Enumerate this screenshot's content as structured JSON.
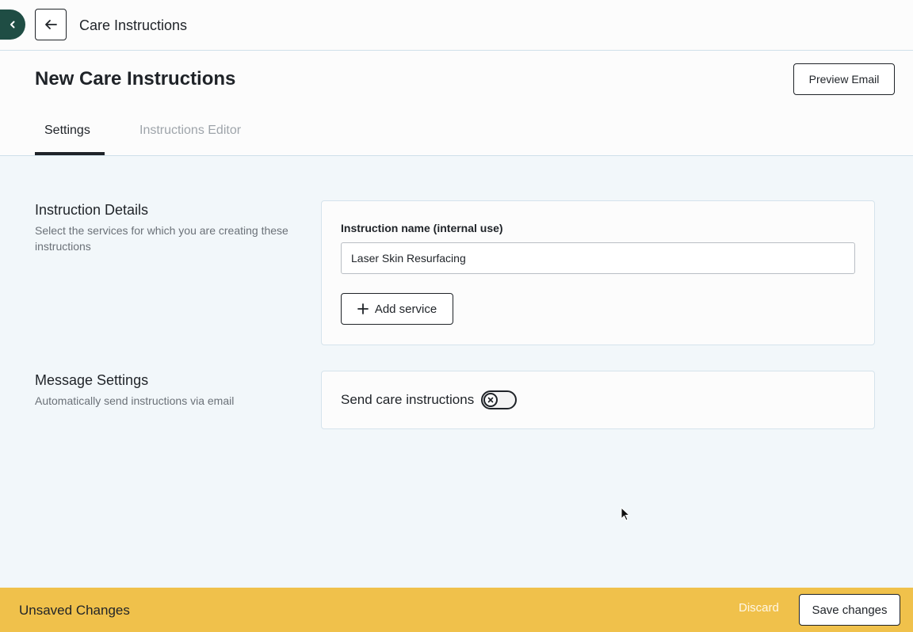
{
  "topbar": {
    "title": "Care Instructions",
    "collapse_icon": "chevron-left-icon",
    "back_icon": "arrow-left-icon"
  },
  "header": {
    "page_title": "New Care Instructions",
    "preview_label": "Preview Email",
    "tabs": [
      {
        "label": "Settings",
        "active": true
      },
      {
        "label": "Instructions Editor",
        "active": false
      }
    ]
  },
  "instruction_details": {
    "title": "Instruction Details",
    "description": "Select the services for which you are creating these instructions",
    "field_label": "Instruction name (internal use)",
    "field_value": "Laser Skin Resurfacing",
    "add_service_label": "Add service",
    "add_icon": "plus-icon"
  },
  "message_settings": {
    "title": "Message Settings",
    "description": "Automatically send instructions via email",
    "toggle_label": "Send care instructions",
    "toggle_on": false
  },
  "footer": {
    "status": "Unsaved Changes",
    "discard_label": "Discard",
    "save_label": "Save changes"
  },
  "colors": {
    "accent_dark_green": "#1f4d44",
    "footer_yellow": "#f0c14b",
    "background": "#f2f7fa"
  }
}
